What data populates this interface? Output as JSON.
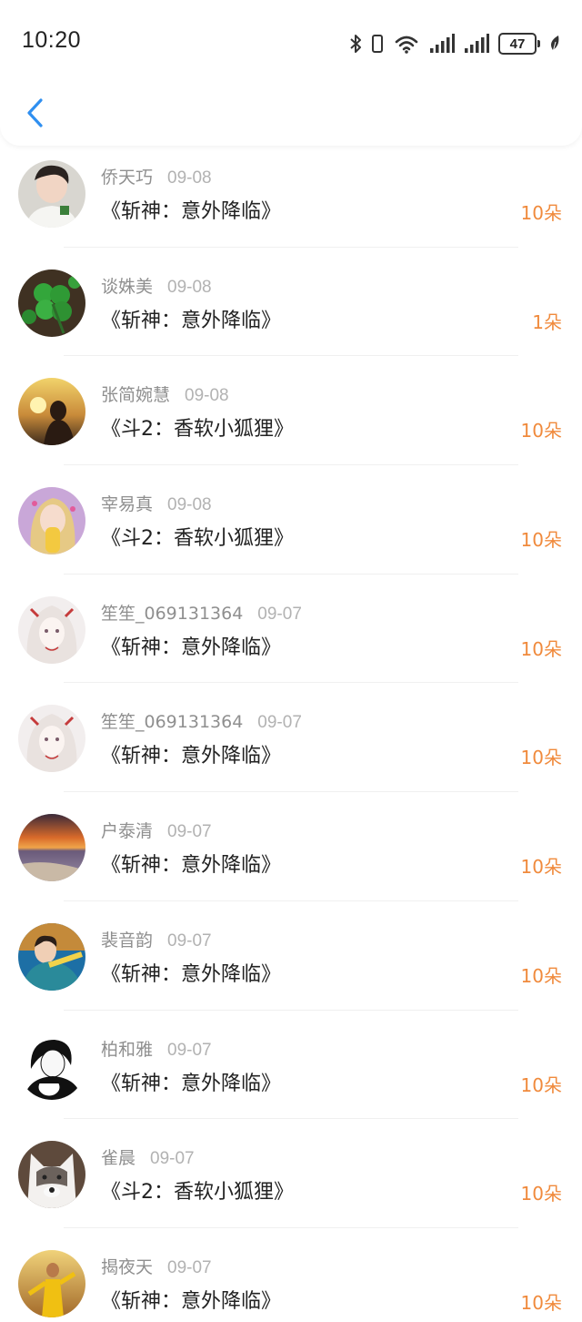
{
  "status_bar": {
    "time": "10:20",
    "battery": "47"
  },
  "header": {
    "back_icon": "chevron-left-icon"
  },
  "colors": {
    "accent": "#f08a3c",
    "back": "#2f8ff0"
  },
  "items": [
    {
      "name": "侨天巧",
      "date": "09-08",
      "title": "《斩神：意外降临》",
      "gift": "10朵",
      "avatar": "photo"
    },
    {
      "name": "谈姝美",
      "date": "09-08",
      "title": "《斩神：意外降临》",
      "gift": "1朵",
      "avatar": "clover"
    },
    {
      "name": "张简婉慧",
      "date": "09-08",
      "title": "《斗2：香软小狐狸》",
      "gift": "10朵",
      "avatar": "sunset-person"
    },
    {
      "name": "宰易真",
      "date": "09-08",
      "title": "《斗2：香软小狐狸》",
      "gift": "10朵",
      "avatar": "girl"
    },
    {
      "name": "笙笙_069131364",
      "date": "09-07",
      "title": "《斩神：意外降临》",
      "gift": "10朵",
      "avatar": "anime"
    },
    {
      "name": "笙笙_069131364",
      "date": "09-07",
      "title": "《斩神：意外降临》",
      "gift": "10朵",
      "avatar": "anime"
    },
    {
      "name": "户泰清",
      "date": "09-07",
      "title": "《斩神：意外降临》",
      "gift": "10朵",
      "avatar": "sea-sunset"
    },
    {
      "name": "裴音韵",
      "date": "09-07",
      "title": "《斩神：意外降临》",
      "gift": "10朵",
      "avatar": "boy"
    },
    {
      "name": "柏和雅",
      "date": "09-07",
      "title": "《斩神：意外降临》",
      "gift": "10朵",
      "avatar": "bw-anime"
    },
    {
      "name": "雀晨",
      "date": "09-07",
      "title": "《斗2：香软小狐狸》",
      "gift": "10朵",
      "avatar": "dog"
    },
    {
      "name": "揭夜天",
      "date": "09-07",
      "title": "《斩神：意外降临》",
      "gift": "10朵",
      "avatar": "player"
    }
  ]
}
